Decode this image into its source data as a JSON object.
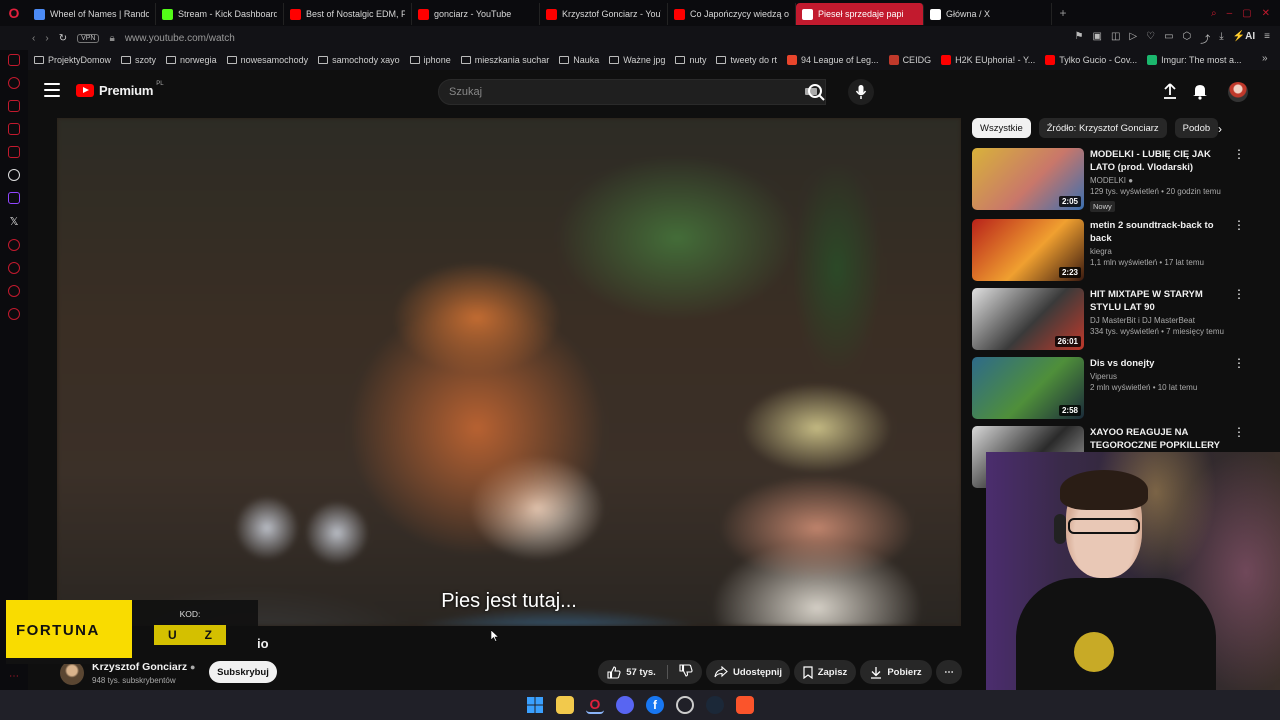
{
  "browser": {
    "tabs": [
      {
        "title": "Wheel of Names | Random",
        "fav_color": "#4c8bf5"
      },
      {
        "title": "Stream - Kick Dashboard",
        "fav_color": "#53fc18"
      },
      {
        "title": "Best of Nostalgic EDM, P",
        "fav_color": "#ff0000"
      },
      {
        "title": "gonciarz - YouTube",
        "fav_color": "#ff0000"
      },
      {
        "title": "Krzysztof Gonciarz - YouT",
        "fav_color": "#ff0000"
      },
      {
        "title": "Co Japończycy wiedzą o",
        "fav_color": "#ff0000"
      },
      {
        "title": "Pieseł sprzedaje papi",
        "fav_color": "#ffffff",
        "active": true
      },
      {
        "title": "Główna / X",
        "fav_color": "#ffffff"
      }
    ],
    "vpn_label": "VPN",
    "url": "www.youtube.com/watch",
    "ai_label": "AI",
    "bookmarks": [
      {
        "label": "ProjektyDomow",
        "type": "folder"
      },
      {
        "label": "szoty",
        "type": "folder"
      },
      {
        "label": "norwegia",
        "type": "folder"
      },
      {
        "label": "nowesamochody",
        "type": "folder"
      },
      {
        "label": "samochody xayo",
        "type": "folder"
      },
      {
        "label": "iphone",
        "type": "folder"
      },
      {
        "label": "mieszkania suchar",
        "type": "folder"
      },
      {
        "label": "Nauka",
        "type": "folder"
      },
      {
        "label": "Ważne jpg",
        "type": "folder"
      },
      {
        "label": "nuty",
        "type": "folder"
      },
      {
        "label": "tweety do rt",
        "type": "folder"
      },
      {
        "label": "94 League of Leg...",
        "type": "site",
        "color": "#e8452c"
      },
      {
        "label": "CEIDG",
        "type": "site",
        "color": "#c0392b"
      },
      {
        "label": "H2K EUphoria! - Y...",
        "type": "site",
        "color": "#ff0000"
      },
      {
        "label": "Tylko Gucio - Cov...",
        "type": "site",
        "color": "#ff0000"
      },
      {
        "label": "Imgur: The most a...",
        "type": "site",
        "color": "#1bb76e"
      }
    ]
  },
  "youtube": {
    "logo_text": "Premium",
    "region": "PL",
    "search_placeholder": "Szukaj",
    "subtitle": "Pies jest tutaj...",
    "video_title_fragment": "io",
    "channel_name": "Krzysztof Gonciarz",
    "subscribers": "948 tys. subskrybentów",
    "subscribe_label": "Subskrybuj",
    "likes": "57 tys.",
    "share_label": "Udostępnij",
    "save_label": "Zapisz",
    "download_label": "Pobierz",
    "chips": [
      {
        "label": "Wszystkie",
        "active": true
      },
      {
        "label": "Źródło: Krzysztof Gonciarz"
      },
      {
        "label": "Podob"
      }
    ],
    "recommendations": [
      {
        "title": "MODELKI - LUBIĘ CIĘ JAK LATO (prod. Vlodarski)",
        "channel": "MODELKI",
        "verified": true,
        "meta": "129 tys. wyświetleń • 20 godzin temu",
        "badge": "Nowy",
        "duration": "2:05",
        "thumb": [
          "#d8b23a",
          "#c9776a",
          "#3a6fb0"
        ]
      },
      {
        "title": "metin 2 soundtrack-back to back",
        "channel": "kiegra",
        "meta": "1,1 mln wyświetleń • 17 lat temu",
        "duration": "2:23",
        "thumb": [
          "#b8221a",
          "#f0a030",
          "#3a1a10"
        ]
      },
      {
        "title": "HIT MIXTAPE W STARYM STYLU LAT 90",
        "channel": "DJ MasterBit i DJ MasterBeat",
        "meta": "334 tys. wyświetleń • 7 miesięcy temu",
        "duration": "26:01",
        "thumb": [
          "#e0e0e0",
          "#3a3a3a",
          "#c0392b"
        ]
      },
      {
        "title": "Dis vs donejty",
        "channel": "Viperus",
        "meta": "2 mln wyświetleń • 10 lat temu",
        "duration": "2:58",
        "thumb": [
          "#2e6a8a",
          "#4f8f3a",
          "#1a2a3a"
        ]
      },
      {
        "title": "XAYOO REAGUJE NA TEGOROCZNE POPKILLERY ...",
        "channel": "",
        "meta": "",
        "duration": "",
        "thumb": [
          "#d8d8d8",
          "#2a2a2a",
          "#b0b0b0"
        ]
      }
    ]
  },
  "overlay": {
    "fortuna_brand": "FORTUNA",
    "code_label": "KOD:",
    "code_chars": [
      "U",
      "Z"
    ]
  }
}
